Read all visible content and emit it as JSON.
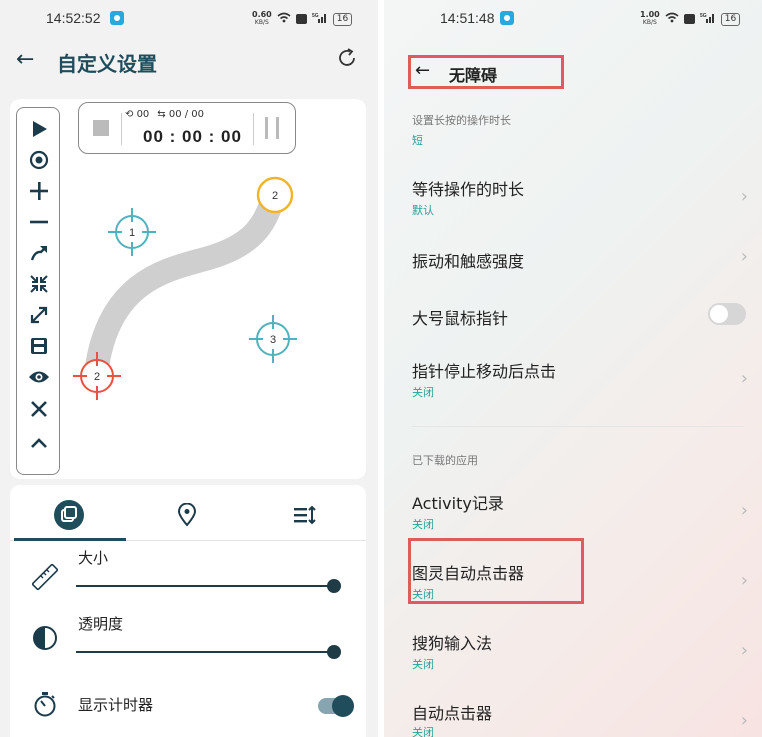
{
  "left": {
    "status": {
      "time": "14:52:52",
      "speed_top": "0.60",
      "speed_unit": "KB/S",
      "net": "5G",
      "battery": "16"
    },
    "header": {
      "title": "自定义设置"
    },
    "timer": {
      "loop_count": "00",
      "loop_progress": "00 / 00",
      "clock": "00 : 00 : 00"
    },
    "targets": [
      {
        "label": "1",
        "color": "#4fb3bf"
      },
      {
        "label": "2",
        "color": "#f0b429"
      },
      {
        "label": "3",
        "color": "#4fb3bf"
      },
      {
        "label": "2",
        "color": "#e8533f"
      }
    ],
    "toolbar_icons": [
      "play-icon",
      "record-icon",
      "plus-icon",
      "minus-icon",
      "swipe-icon",
      "shrink-icon",
      "expand-icon",
      "save-icon",
      "eye-icon",
      "close-icon",
      "chevron-up-icon"
    ],
    "tabs": [
      "target-tab",
      "location-tab",
      "sort-tab"
    ],
    "options": {
      "size_label": "大小",
      "size_value": 1.0,
      "opacity_label": "透明度",
      "opacity_value": 1.0,
      "timer_label": "显示计时器",
      "timer_on": true
    }
  },
  "right": {
    "status": {
      "time": "14:51:48",
      "speed_top": "1.00",
      "speed_unit": "KB/S",
      "battery": "16"
    },
    "header": {
      "title": "无障碍"
    },
    "section_top": "设置长按的操作时长",
    "section_top_value": "短",
    "items": [
      {
        "name": "等待操作的时长",
        "value": "默认"
      },
      {
        "name": "振动和触感强度",
        "value": ""
      },
      {
        "name": "大号鼠标指针",
        "value": ""
      },
      {
        "name": "指针停止移动后点击",
        "value": "关闭"
      }
    ],
    "section_apps": "已下载的应用",
    "apps": [
      {
        "name": "Activity记录",
        "value": "关闭"
      },
      {
        "name": "图灵自动点击器",
        "value": "关闭"
      },
      {
        "name": "搜狗输入法",
        "value": "关闭"
      },
      {
        "name": "自动点击器",
        "value": "关闭"
      }
    ]
  }
}
